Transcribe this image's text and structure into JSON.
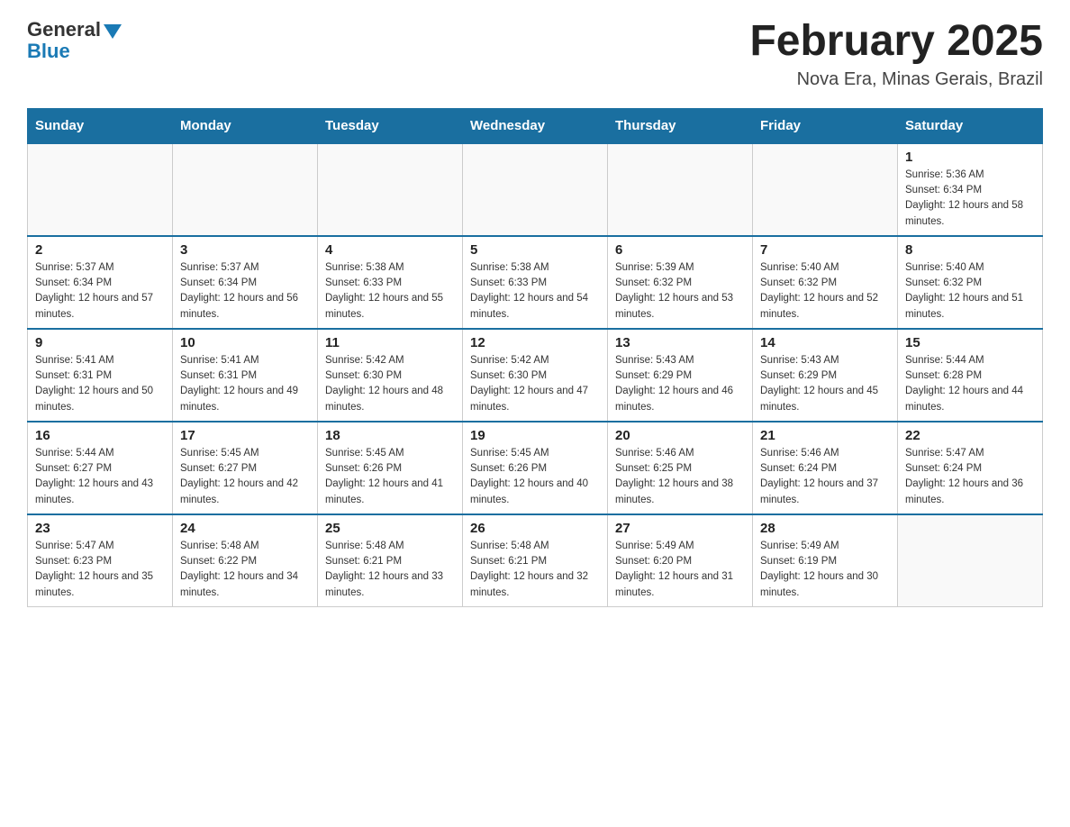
{
  "header": {
    "logo_general": "General",
    "logo_blue": "Blue",
    "month_title": "February 2025",
    "location": "Nova Era, Minas Gerais, Brazil"
  },
  "days_of_week": [
    "Sunday",
    "Monday",
    "Tuesday",
    "Wednesday",
    "Thursday",
    "Friday",
    "Saturday"
  ],
  "weeks": [
    [
      {
        "day": "",
        "info": ""
      },
      {
        "day": "",
        "info": ""
      },
      {
        "day": "",
        "info": ""
      },
      {
        "day": "",
        "info": ""
      },
      {
        "day": "",
        "info": ""
      },
      {
        "day": "",
        "info": ""
      },
      {
        "day": "1",
        "info": "Sunrise: 5:36 AM\nSunset: 6:34 PM\nDaylight: 12 hours and 58 minutes."
      }
    ],
    [
      {
        "day": "2",
        "info": "Sunrise: 5:37 AM\nSunset: 6:34 PM\nDaylight: 12 hours and 57 minutes."
      },
      {
        "day": "3",
        "info": "Sunrise: 5:37 AM\nSunset: 6:34 PM\nDaylight: 12 hours and 56 minutes."
      },
      {
        "day": "4",
        "info": "Sunrise: 5:38 AM\nSunset: 6:33 PM\nDaylight: 12 hours and 55 minutes."
      },
      {
        "day": "5",
        "info": "Sunrise: 5:38 AM\nSunset: 6:33 PM\nDaylight: 12 hours and 54 minutes."
      },
      {
        "day": "6",
        "info": "Sunrise: 5:39 AM\nSunset: 6:32 PM\nDaylight: 12 hours and 53 minutes."
      },
      {
        "day": "7",
        "info": "Sunrise: 5:40 AM\nSunset: 6:32 PM\nDaylight: 12 hours and 52 minutes."
      },
      {
        "day": "8",
        "info": "Sunrise: 5:40 AM\nSunset: 6:32 PM\nDaylight: 12 hours and 51 minutes."
      }
    ],
    [
      {
        "day": "9",
        "info": "Sunrise: 5:41 AM\nSunset: 6:31 PM\nDaylight: 12 hours and 50 minutes."
      },
      {
        "day": "10",
        "info": "Sunrise: 5:41 AM\nSunset: 6:31 PM\nDaylight: 12 hours and 49 minutes."
      },
      {
        "day": "11",
        "info": "Sunrise: 5:42 AM\nSunset: 6:30 PM\nDaylight: 12 hours and 48 minutes."
      },
      {
        "day": "12",
        "info": "Sunrise: 5:42 AM\nSunset: 6:30 PM\nDaylight: 12 hours and 47 minutes."
      },
      {
        "day": "13",
        "info": "Sunrise: 5:43 AM\nSunset: 6:29 PM\nDaylight: 12 hours and 46 minutes."
      },
      {
        "day": "14",
        "info": "Sunrise: 5:43 AM\nSunset: 6:29 PM\nDaylight: 12 hours and 45 minutes."
      },
      {
        "day": "15",
        "info": "Sunrise: 5:44 AM\nSunset: 6:28 PM\nDaylight: 12 hours and 44 minutes."
      }
    ],
    [
      {
        "day": "16",
        "info": "Sunrise: 5:44 AM\nSunset: 6:27 PM\nDaylight: 12 hours and 43 minutes."
      },
      {
        "day": "17",
        "info": "Sunrise: 5:45 AM\nSunset: 6:27 PM\nDaylight: 12 hours and 42 minutes."
      },
      {
        "day": "18",
        "info": "Sunrise: 5:45 AM\nSunset: 6:26 PM\nDaylight: 12 hours and 41 minutes."
      },
      {
        "day": "19",
        "info": "Sunrise: 5:45 AM\nSunset: 6:26 PM\nDaylight: 12 hours and 40 minutes."
      },
      {
        "day": "20",
        "info": "Sunrise: 5:46 AM\nSunset: 6:25 PM\nDaylight: 12 hours and 38 minutes."
      },
      {
        "day": "21",
        "info": "Sunrise: 5:46 AM\nSunset: 6:24 PM\nDaylight: 12 hours and 37 minutes."
      },
      {
        "day": "22",
        "info": "Sunrise: 5:47 AM\nSunset: 6:24 PM\nDaylight: 12 hours and 36 minutes."
      }
    ],
    [
      {
        "day": "23",
        "info": "Sunrise: 5:47 AM\nSunset: 6:23 PM\nDaylight: 12 hours and 35 minutes."
      },
      {
        "day": "24",
        "info": "Sunrise: 5:48 AM\nSunset: 6:22 PM\nDaylight: 12 hours and 34 minutes."
      },
      {
        "day": "25",
        "info": "Sunrise: 5:48 AM\nSunset: 6:21 PM\nDaylight: 12 hours and 33 minutes."
      },
      {
        "day": "26",
        "info": "Sunrise: 5:48 AM\nSunset: 6:21 PM\nDaylight: 12 hours and 32 minutes."
      },
      {
        "day": "27",
        "info": "Sunrise: 5:49 AM\nSunset: 6:20 PM\nDaylight: 12 hours and 31 minutes."
      },
      {
        "day": "28",
        "info": "Sunrise: 5:49 AM\nSunset: 6:19 PM\nDaylight: 12 hours and 30 minutes."
      },
      {
        "day": "",
        "info": ""
      }
    ]
  ]
}
